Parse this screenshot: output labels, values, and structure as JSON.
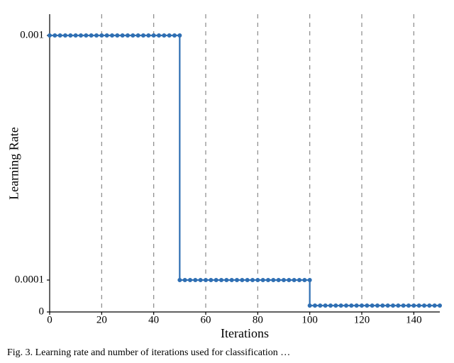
{
  "chart_data": {
    "type": "line",
    "title": "",
    "xlabel": "Iterations",
    "ylabel": "Learning Rate",
    "x_ticks": [
      0,
      20,
      40,
      60,
      80,
      100,
      120,
      140
    ],
    "y_ticks_labels": [
      "0",
      "0.0001",
      "0.001"
    ],
    "y_ticks_values": [
      0,
      0.0001,
      0.001
    ],
    "legend": null,
    "grid_vertical_at": [
      20,
      40,
      60,
      80,
      100,
      120,
      140
    ],
    "xlim": [
      0,
      150
    ],
    "ylim_log_like": [
      0,
      0.001
    ],
    "note": "Three visible plateaus at 0.001 (iter 0–50), 0.0001 (iter 50–100), and a lower level slightly above the x-axis (iter 100–150).",
    "series": [
      {
        "name": "learning_rate",
        "marker": "circle",
        "color": "#2f6fb3",
        "segments": [
          {
            "iterations": [
              0,
              50
            ],
            "value": 0.001
          },
          {
            "iterations": [
              50,
              100
            ],
            "value": 0.0001
          },
          {
            "iterations": [
              100,
              150
            ],
            "value": 2e-05
          }
        ],
        "marker_step": 2
      }
    ]
  },
  "axes": {
    "x_title": "Iterations",
    "y_title": "Learning Rate"
  },
  "caption": "Fig. 3.  Learning rate and number of iterations used for classification …"
}
